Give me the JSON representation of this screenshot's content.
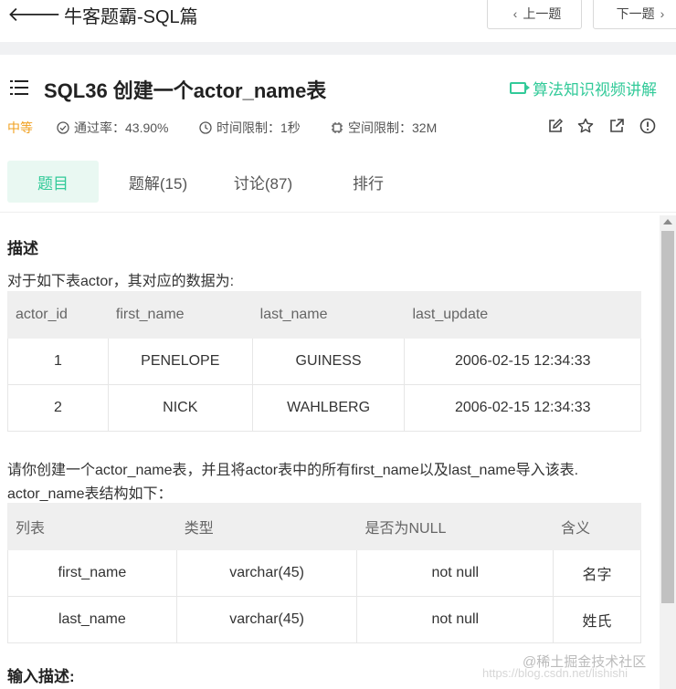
{
  "header": {
    "back_arrow": "🡐",
    "title": "牛客题霸-SQL篇",
    "prev_label": "上一题",
    "next_label": "下一题"
  },
  "problem": {
    "title": "SQL36  创建一个actor_name表",
    "video_link": "算法知识视频讲解",
    "difficulty": "中等",
    "pass_rate": "通过率：43.90%",
    "time_limit": "时间限制：1秒",
    "space_limit": "空间限制：32M"
  },
  "tabs": [
    {
      "label": "题目",
      "active": true
    },
    {
      "label": "题解(15)",
      "active": false
    },
    {
      "label": "讨论(87)",
      "active": false
    },
    {
      "label": "排行",
      "active": false
    }
  ],
  "content": {
    "heading_description": "描述",
    "intro": "对于如下表actor，其对应的数据为:",
    "actor_table": {
      "headers": [
        "actor_id",
        "first_name",
        "last_name",
        "last_update"
      ],
      "rows": [
        [
          "1",
          "PENELOPE",
          "GUINESS",
          "2006-02-15 12:34:33"
        ],
        [
          "2",
          "NICK",
          "WAHLBERG",
          "2006-02-15 12:34:33"
        ]
      ]
    },
    "instruction_line1": "请你创建一个actor_name表，并且将actor表中的所有first_name以及last_name导入该表.",
    "instruction_line2": "actor_name表结构如下：",
    "schema_table": {
      "headers": [
        "列表",
        "类型",
        "是否为NULL",
        "含义"
      ],
      "rows": [
        [
          "first_name",
          "varchar(45)",
          "not null",
          "名字"
        ],
        [
          "last_name",
          "varchar(45)",
          "not null",
          "姓氏"
        ]
      ]
    },
    "heading_input": "输入描述:"
  },
  "watermark": {
    "text": "@稀土掘金技术社区",
    "url": "https://blog.csdn.net/lishishi"
  },
  "colors": {
    "accent": "#32ca99",
    "difficulty": "#f0a020",
    "table_header_bg": "#efefef"
  }
}
